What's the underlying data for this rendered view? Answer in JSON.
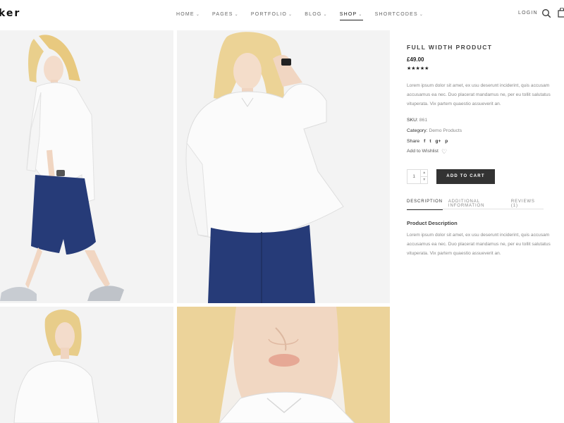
{
  "header": {
    "logo": "ker",
    "nav": [
      {
        "label": "HOME",
        "has_dropdown": true,
        "active": false
      },
      {
        "label": "PAGES",
        "has_dropdown": true,
        "active": false
      },
      {
        "label": "PORTFOLIO",
        "has_dropdown": true,
        "active": false
      },
      {
        "label": "BLOG",
        "has_dropdown": true,
        "active": false
      },
      {
        "label": "SHOP",
        "has_dropdown": true,
        "active": true
      },
      {
        "label": "SHORTCODES",
        "has_dropdown": true,
        "active": false
      }
    ],
    "login": "LOGIN",
    "icons": [
      "search-icon",
      "shopping-bag-icon"
    ]
  },
  "product": {
    "title": "FULL WIDTH PRODUCT",
    "price": "£49.00",
    "rating": "★★★★★",
    "description": "Lorem ipsum dolor sit amet, ex usu deserunt inciderint, quis accusam accusamus ea nec. Duo placerat mandamus ne, per eu tollit salutatus vituperata. Vix partem quaestio assueverit an.",
    "sku_label": "SKU:",
    "sku": "861",
    "category_label": "Category:",
    "category": "Demo Products",
    "share_label": "Share",
    "share_icons": [
      "f",
      "t",
      "g+",
      "p"
    ],
    "wishlist": "Add to Wishlist",
    "quantity": "1",
    "add_to_cart": "ADD TO CART"
  },
  "tabs": [
    {
      "label": "DESCRIPTION",
      "active": true
    },
    {
      "label": "ADDITIONAL INFORMATION",
      "active": false
    },
    {
      "label": "REVIEWS (1)",
      "active": false
    }
  ],
  "tab_content": {
    "title": "Product Description",
    "text": "Lorem ipsum dolor sit amet, ex usu deserunt inciderint, quis accusam accusamus ea nec. Duo placerat mandamus ne, per eu tollit salutatus vituperata. Vix partem quaestio assueverit an."
  }
}
